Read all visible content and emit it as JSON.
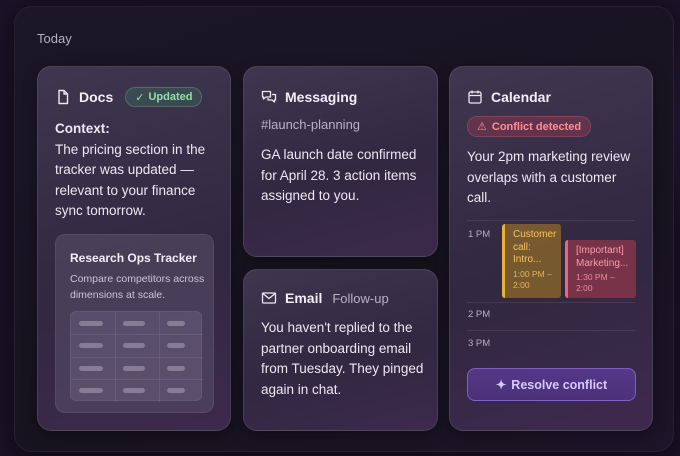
{
  "section_label": "Today",
  "docs": {
    "title": "Docs",
    "icon": "document-icon",
    "badge": "Updated",
    "context_label": "Context:",
    "context_text": "The pricing section in the tracker was updated — relevant to your finance sync tomorrow.",
    "preview": {
      "title": "Research Ops Tracker",
      "description": "Compare competitors across dimensions at scale."
    }
  },
  "messaging": {
    "title": "Messaging",
    "icon": "chat-bubbles-icon",
    "channel": "#launch-planning",
    "body": "GA launch date confirmed for April 28. 3 action items assigned to you."
  },
  "email": {
    "title": "Email",
    "icon": "envelope-icon",
    "tag": "Follow-up",
    "body": "You haven't replied to the partner onboarding email from Tuesday. They pinged again in chat."
  },
  "calendar": {
    "title": "Calendar",
    "icon": "calendar-icon",
    "badge": "Conflict detected",
    "body": "Your 2pm marketing review overlaps with a customer call.",
    "time_labels": [
      "1 PM",
      "2 PM",
      "3 PM"
    ],
    "events": [
      {
        "name": "Customer call: Intro...",
        "time": "1:00 PM – 2:00"
      },
      {
        "name": "[Important] Marketing...",
        "time": "1:30 PM – 2:00"
      }
    ],
    "resolve_label": "Resolve conflict",
    "colors": {
      "event_a": "#e8b23a",
      "event_b": "#e36a80",
      "conflict": "#ff8f96",
      "updated": "#8fe0a9",
      "accent": "#a782ff"
    }
  }
}
